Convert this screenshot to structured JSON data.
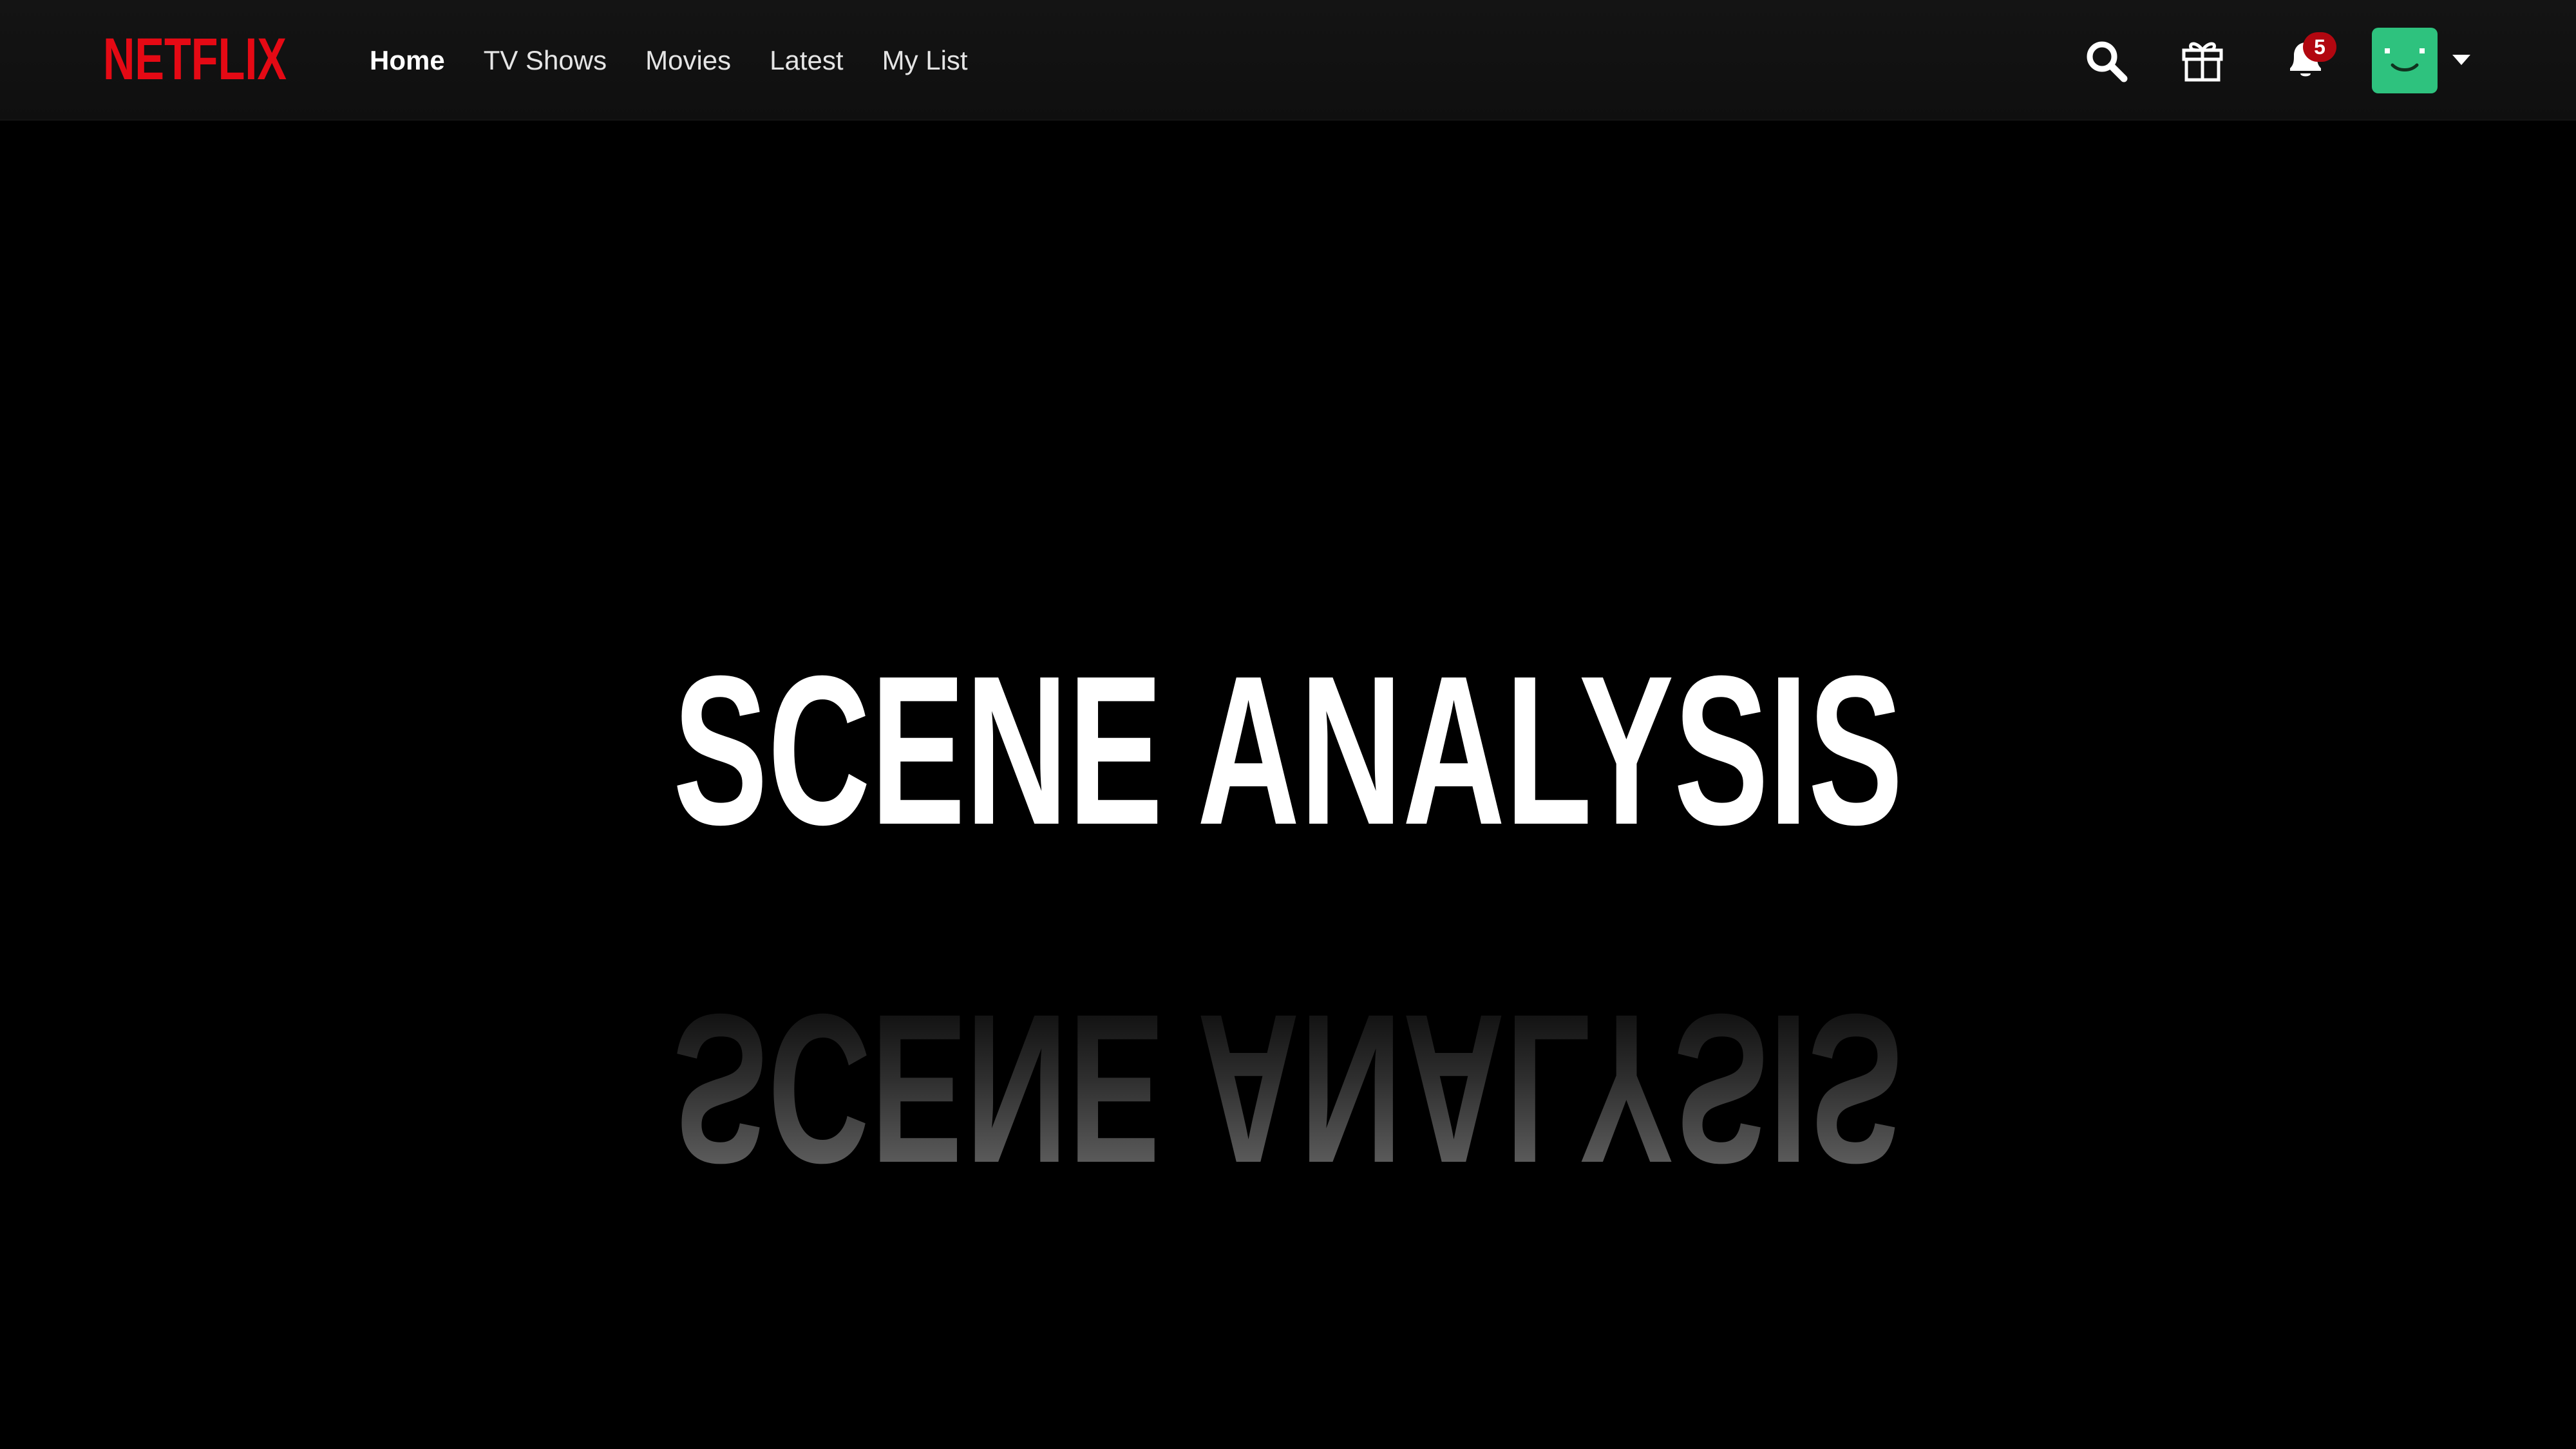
{
  "nav": {
    "logo_text": "NETFLIX",
    "links": [
      {
        "label": "Home",
        "active": true
      },
      {
        "label": "TV Shows",
        "active": false
      },
      {
        "label": "Movies",
        "active": false
      },
      {
        "label": "Latest",
        "active": false
      },
      {
        "label": "My List",
        "active": false
      }
    ],
    "notification_count": "5",
    "icons": {
      "search": "search-icon",
      "gift": "gift-icon",
      "notifications": "bell-icon",
      "profile": "profile-avatar",
      "menu": "caret-down-icon"
    }
  },
  "hero": {
    "title": "SCENE ANALYSIS"
  },
  "colors": {
    "brand_red": "#e50914",
    "badge_red": "#b20710",
    "avatar_green": "#2ec27e",
    "background": "#000000",
    "nav_background": "#141414"
  }
}
